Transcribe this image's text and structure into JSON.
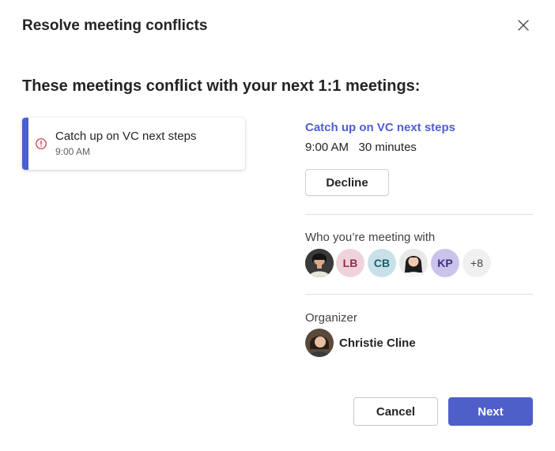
{
  "dialog": {
    "title": "Resolve meeting conflicts",
    "close_icon": "close-icon"
  },
  "section_heading": "These meetings conflict with your next 1:1 meetings:",
  "conflicts": [
    {
      "title": "Catch up on VC next steps",
      "time": "9:00 AM",
      "status_icon": "warning-circle-icon",
      "status_color": "#c4314b",
      "accent_color": "#4b5fd0"
    }
  ],
  "details": {
    "title": "Catch up on VC next steps",
    "time": "9:00 AM",
    "duration": "30 minutes",
    "time_line": "9:00 AM   30 minutes",
    "decline_label": "Decline"
  },
  "attendees": {
    "label": "Who you’re meeting with",
    "avatars": [
      {
        "type": "photo",
        "icon": "person-photo-avatar"
      },
      {
        "type": "initials",
        "initials": "LB",
        "bg": "#eed3da",
        "fg": "#9b2a4a"
      },
      {
        "type": "initials",
        "initials": "CB",
        "bg": "#c8e1e8",
        "fg": "#1f5d6e"
      },
      {
        "type": "photo",
        "icon": "person-photo-avatar"
      },
      {
        "type": "initials",
        "initials": "KP",
        "bg": "#cbc3ea",
        "fg": "#3d2d8a"
      },
      {
        "type": "overflow",
        "text": "+8",
        "bg": "#f0f0f0",
        "fg": "#424242"
      }
    ]
  },
  "organizer": {
    "label": "Organizer",
    "name": "Christie Cline"
  },
  "footer": {
    "cancel_label": "Cancel",
    "next_label": "Next"
  },
  "colors": {
    "brand": "#4f5fc9",
    "link": "#4d5fd3",
    "divider": "#e0e0e0"
  }
}
